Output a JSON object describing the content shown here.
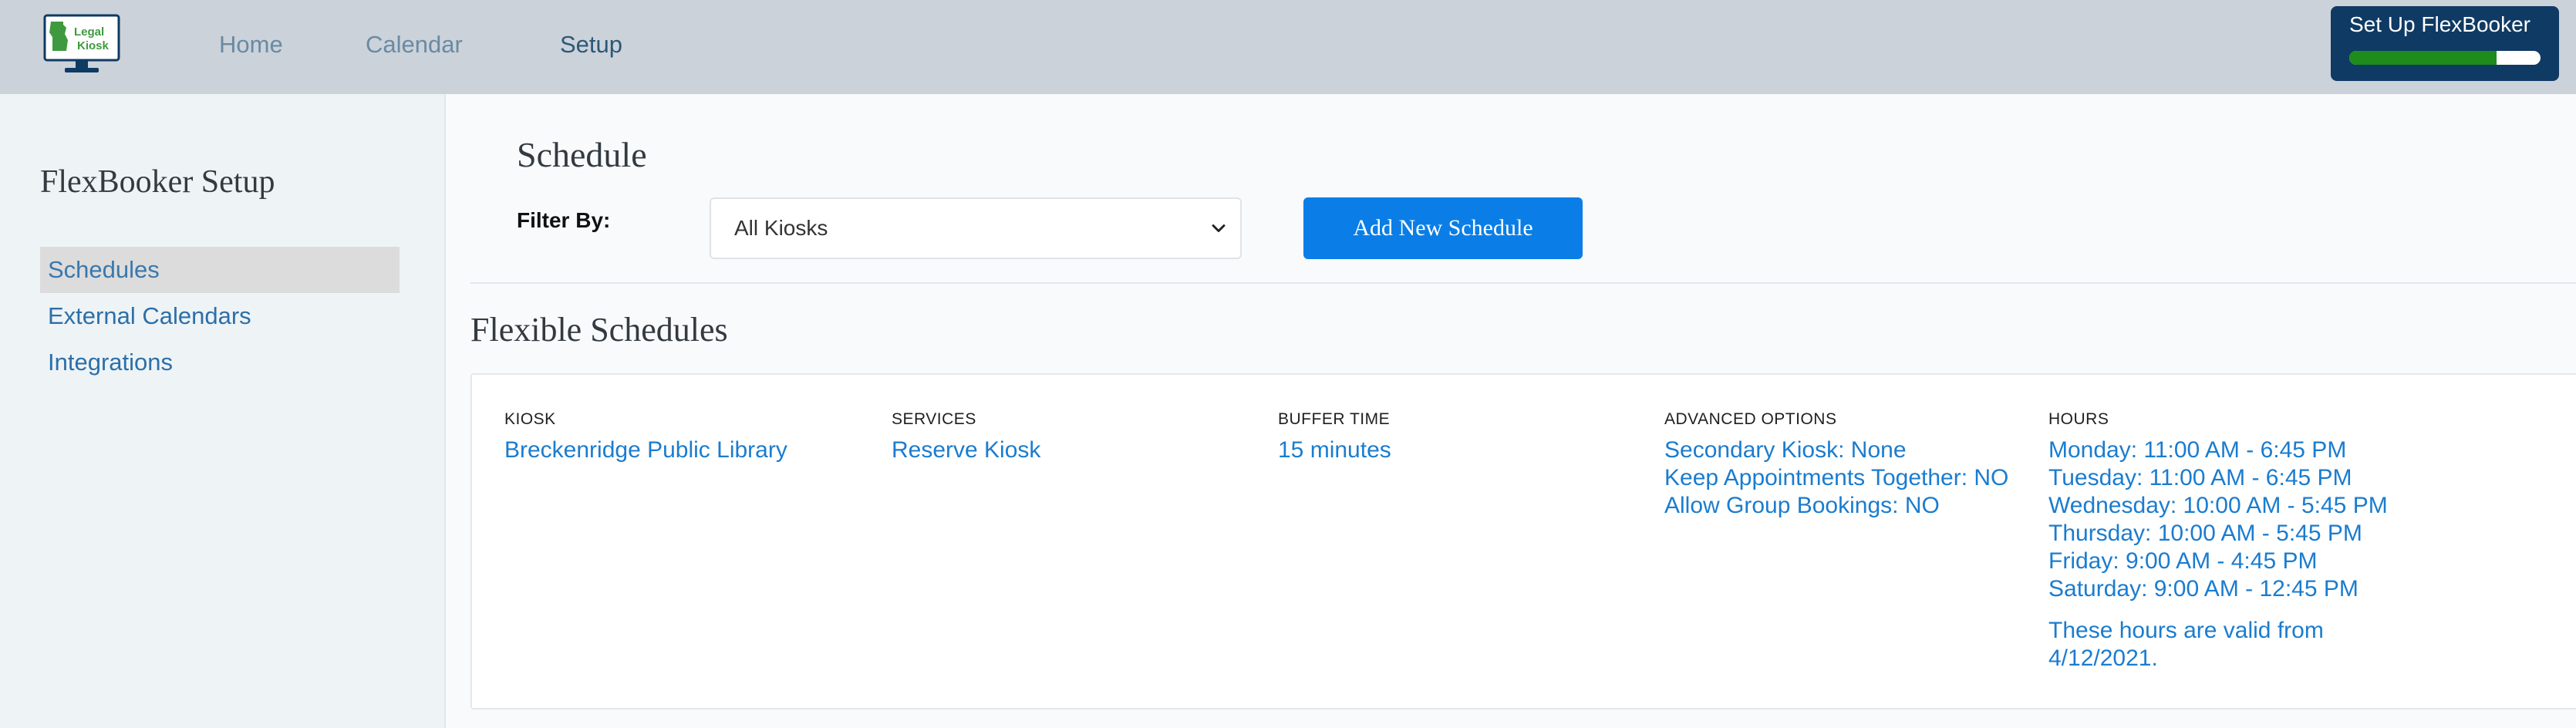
{
  "header": {
    "logo_text": [
      "Legal",
      "Kiosk"
    ],
    "nav": [
      {
        "label": "Home"
      },
      {
        "label": "Calendar"
      },
      {
        "label": "Setup"
      }
    ],
    "active_nav": "Setup",
    "setup_widget": {
      "title": "Set Up FlexBooker",
      "progress_percent": 77
    }
  },
  "sidebar": {
    "title": "FlexBooker Setup",
    "items": [
      {
        "label": "Schedules",
        "active": true
      },
      {
        "label": "External Calendars",
        "active": false
      },
      {
        "label": "Integrations",
        "active": false
      }
    ]
  },
  "main": {
    "schedule_title": "Schedule",
    "filter_label": "Filter By:",
    "filter_value": "All Kiosks",
    "add_button_label": "Add New Schedule",
    "flexible_title": "Flexible Schedules",
    "schedule_card": {
      "kiosk": {
        "header": "KIOSK",
        "value": "Breckenridge Public Library"
      },
      "services": {
        "header": "SERVICES",
        "value": "Reserve Kiosk"
      },
      "buffer": {
        "header": "BUFFER TIME",
        "value": "15 minutes"
      },
      "advanced": {
        "header": "ADVANCED OPTIONS",
        "lines": [
          "Secondary Kiosk: None",
          "Keep Appointments Together: NO",
          "Allow Group Bookings: NO"
        ]
      },
      "hours": {
        "header": "HOURS",
        "lines": [
          "Monday: 11:00 AM - 6:45 PM",
          "Tuesday: 11:00 AM - 6:45 PM",
          "Wednesday: 10:00 AM - 5:45 PM",
          "Thursday: 10:00 AM - 5:45 PM",
          "Friday: 9:00 AM - 4:45 PM",
          "Saturday: 9:00 AM - 12:45 PM"
        ],
        "note_lines": [
          "These hours are valid from",
          "4/12/2021."
        ]
      }
    }
  },
  "colors": {
    "topbar": "#cbd2d9",
    "link": "#1a7ccf",
    "button": "#0a7ee6",
    "widget": "#0f3a63",
    "progress": "#1d8c1d"
  },
  "icons": {
    "logo": "legal-kiosk-monitor-logo",
    "select": "chevron-down-icon"
  }
}
